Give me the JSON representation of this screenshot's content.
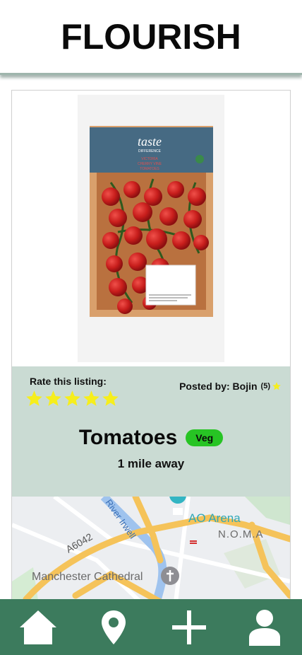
{
  "app": {
    "brand": "FLOURISH"
  },
  "listing": {
    "rate_label": "Rate this listing:",
    "rating_stars": 5,
    "posted_by": "Posted by: Bojin",
    "poster_rating_count": "(5)",
    "title": "Tomatoes",
    "badge": "Veg",
    "distance": "1 mile away",
    "package_text": [
      "taste",
      "DIFFERENCE",
      "VICTORIA",
      "CHERRY VINE",
      "TOMATOES"
    ]
  },
  "map": {
    "labels": [
      "AO Arena",
      "N.O.M.A",
      "Manchester Cathedral",
      "River Irwell",
      "A6042"
    ]
  },
  "nav": {
    "items": [
      "home-icon",
      "location-icon",
      "add-icon",
      "profile-icon"
    ]
  },
  "colors": {
    "header_bg": "#ffffff",
    "info_bg": "#cadbd3",
    "nav_bg": "#3c7b5d",
    "badge": "#27c424",
    "star": "#f6ee1c"
  }
}
